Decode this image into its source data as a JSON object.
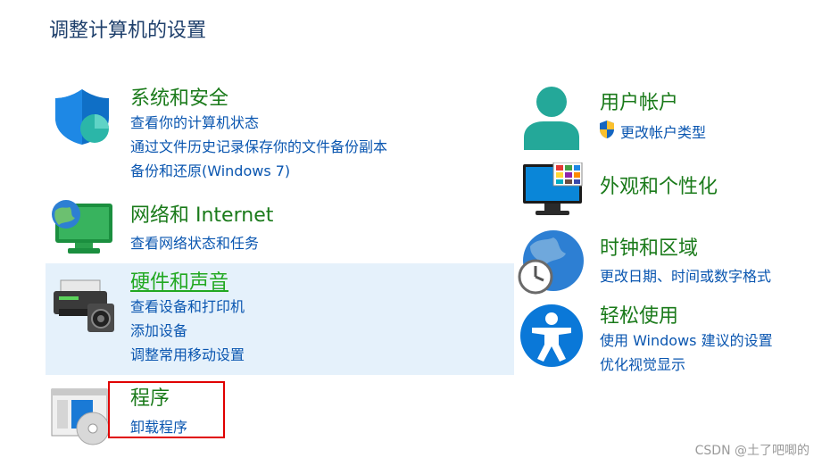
{
  "page": {
    "title": "调整计算机的设置"
  },
  "left": [
    {
      "id": "system-security",
      "title": "系统和安全",
      "links": [
        "查看你的计算机状态",
        "通过文件历史记录保存你的文件备份副本",
        "备份和还原(Windows 7)"
      ],
      "icon": "shield-icon"
    },
    {
      "id": "network",
      "title": "网络和 Internet",
      "links": [
        "查看网络状态和任务"
      ],
      "icon": "network-globe-icon"
    },
    {
      "id": "hardware",
      "title": "硬件和声音",
      "links": [
        "查看设备和打印机",
        "添加设备",
        "调整常用移动设置"
      ],
      "icon": "printer-icon"
    },
    {
      "id": "programs",
      "title": "程序",
      "links": [
        "卸载程序"
      ],
      "icon": "programs-disc-icon"
    }
  ],
  "right": [
    {
      "id": "user-accounts",
      "title": "用户帐户",
      "links": [
        "更改帐户类型"
      ],
      "icon": "user-icon"
    },
    {
      "id": "appearance",
      "title": "外观和个性化",
      "links": [],
      "icon": "monitor-icon"
    },
    {
      "id": "clock-region",
      "title": "时钟和区域",
      "links": [
        "更改日期、时间或数字格式"
      ],
      "icon": "clock-globe-icon"
    },
    {
      "id": "ease-of-access",
      "title": "轻松使用",
      "links": [
        "使用 Windows 建议的设置",
        "优化视觉显示"
      ],
      "icon": "accessibility-icon"
    }
  ],
  "watermark": "CSDN @土了吧唧的",
  "colors": {
    "title_green": "#1a7a1a",
    "link_blue": "#0a56b0",
    "hover_bg": "#e5f1fb",
    "highlight_red": "#e00000"
  }
}
